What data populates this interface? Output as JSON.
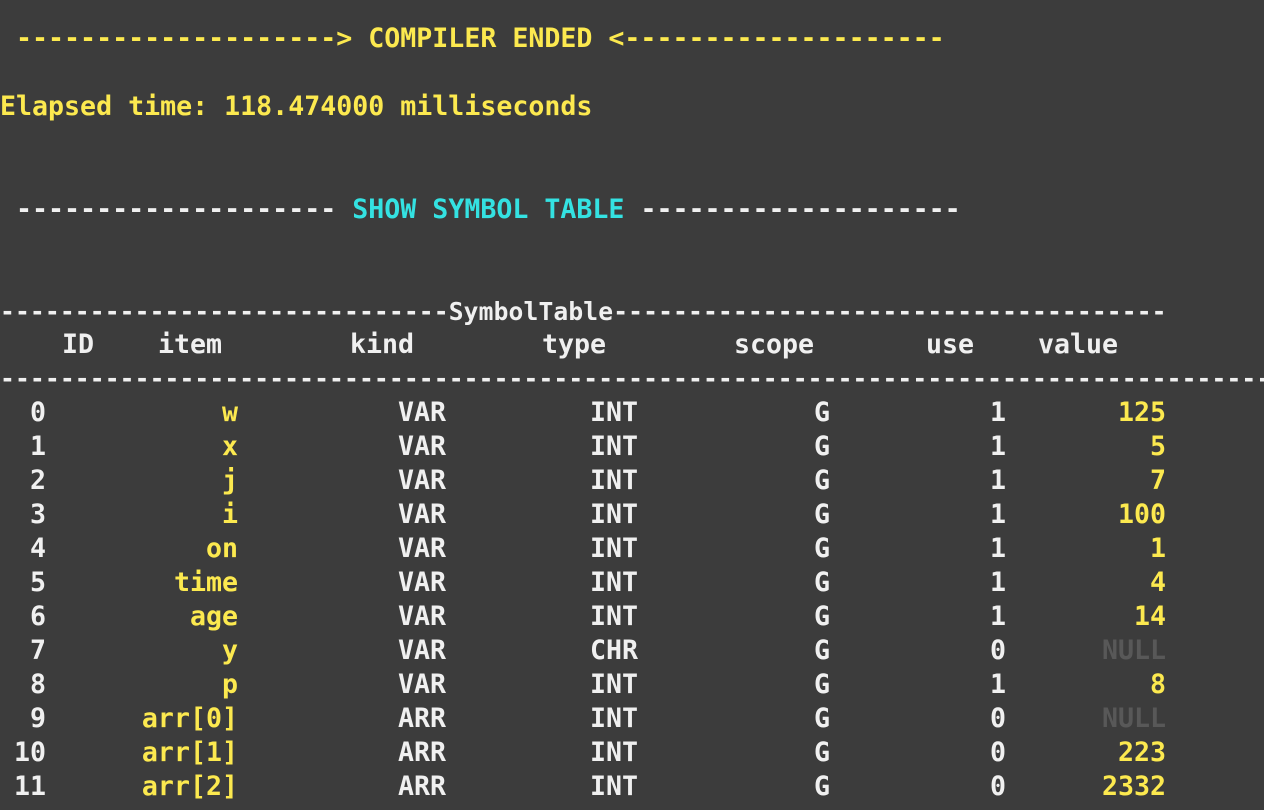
{
  "terminal": {
    "compiler_ended": " --------------------> COMPILER ENDED <--------------------",
    "elapsed": "Elapsed time: 118.474000 milliseconds",
    "show_left_dashes": " -------------------- ",
    "show_title": "SHOW SYMBOL TABLE",
    "show_right_dashes": " --------------------",
    "table_title_line": "------------------------------SymbolTable-------------------------------------",
    "header_line": "   ID    item        kind        type        scope       use    value",
    "separator_line": "----------------------------------------------------------------------------------------",
    "headers": {
      "id": "ID",
      "item": "item",
      "kind": "kind",
      "type": "type",
      "scope": "scope",
      "use": "use",
      "value": "value"
    },
    "rows": [
      {
        "id": "0",
        "item": "w",
        "kind": "VAR",
        "type": "INT",
        "scope": "G",
        "use": "1",
        "value": "125",
        "null": false
      },
      {
        "id": "1",
        "item": "x",
        "kind": "VAR",
        "type": "INT",
        "scope": "G",
        "use": "1",
        "value": "5",
        "null": false
      },
      {
        "id": "2",
        "item": "j",
        "kind": "VAR",
        "type": "INT",
        "scope": "G",
        "use": "1",
        "value": "7",
        "null": false
      },
      {
        "id": "3",
        "item": "i",
        "kind": "VAR",
        "type": "INT",
        "scope": "G",
        "use": "1",
        "value": "100",
        "null": false
      },
      {
        "id": "4",
        "item": "on",
        "kind": "VAR",
        "type": "INT",
        "scope": "G",
        "use": "1",
        "value": "1",
        "null": false
      },
      {
        "id": "5",
        "item": "time",
        "kind": "VAR",
        "type": "INT",
        "scope": "G",
        "use": "1",
        "value": "4",
        "null": false
      },
      {
        "id": "6",
        "item": "age",
        "kind": "VAR",
        "type": "INT",
        "scope": "G",
        "use": "1",
        "value": "14",
        "null": false
      },
      {
        "id": "7",
        "item": "y",
        "kind": "VAR",
        "type": "CHR",
        "scope": "G",
        "use": "0",
        "value": "NULL",
        "null": true
      },
      {
        "id": "8",
        "item": "p",
        "kind": "VAR",
        "type": "INT",
        "scope": "G",
        "use": "1",
        "value": "8",
        "null": false
      },
      {
        "id": "9",
        "item": "arr[0]",
        "kind": "ARR",
        "type": "INT",
        "scope": "G",
        "use": "0",
        "value": "NULL",
        "null": true
      },
      {
        "id": "10",
        "item": "arr[1]",
        "kind": "ARR",
        "type": "INT",
        "scope": "G",
        "use": "0",
        "value": "223",
        "null": false
      },
      {
        "id": "11",
        "item": "arr[2]",
        "kind": "ARR",
        "type": "INT",
        "scope": "G",
        "use": "0",
        "value": "2332",
        "null": false
      }
    ]
  },
  "colors": {
    "background": "#3c3c3c",
    "yellow": "#fce94f",
    "cyan": "#34e2e2",
    "white": "#f0f0f0",
    "null_gray": "#585858"
  }
}
